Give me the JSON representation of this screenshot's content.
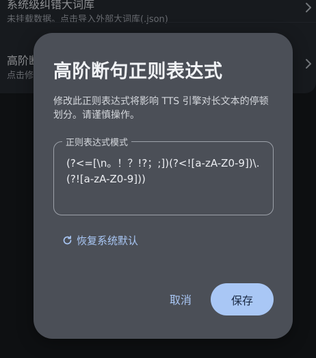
{
  "settings_list": {
    "items": [
      {
        "title": "系统级纠错大词库",
        "subtitle": "未挂载数据。点击导入外部大词库(.json)"
      },
      {
        "title": "高阶断句正则表达式",
        "subtitle": "点击修改断句规则"
      }
    ]
  },
  "dialog": {
    "title": "高阶断句正则表达式",
    "description": "修改此正则表达式将影响 TTS 引擎对长文本的停顿划分。请谨慎操作。",
    "field": {
      "label": "正则表达式模式",
      "value": "(?<=[\\n。！？!?；;])(?<![a-zA-Z0-9])\\.(?![a-zA-Z0-9]))"
    },
    "restore_label": "恢复系统默认",
    "cancel_label": "取消",
    "save_label": "保存"
  },
  "colors": {
    "accent": "#a9c7f5",
    "dialog_surface": "#4b4f57",
    "on_accent": "#1b2a44"
  },
  "icons": {
    "list_chevron": "chevron-right-icon",
    "restore": "refresh-icon"
  }
}
